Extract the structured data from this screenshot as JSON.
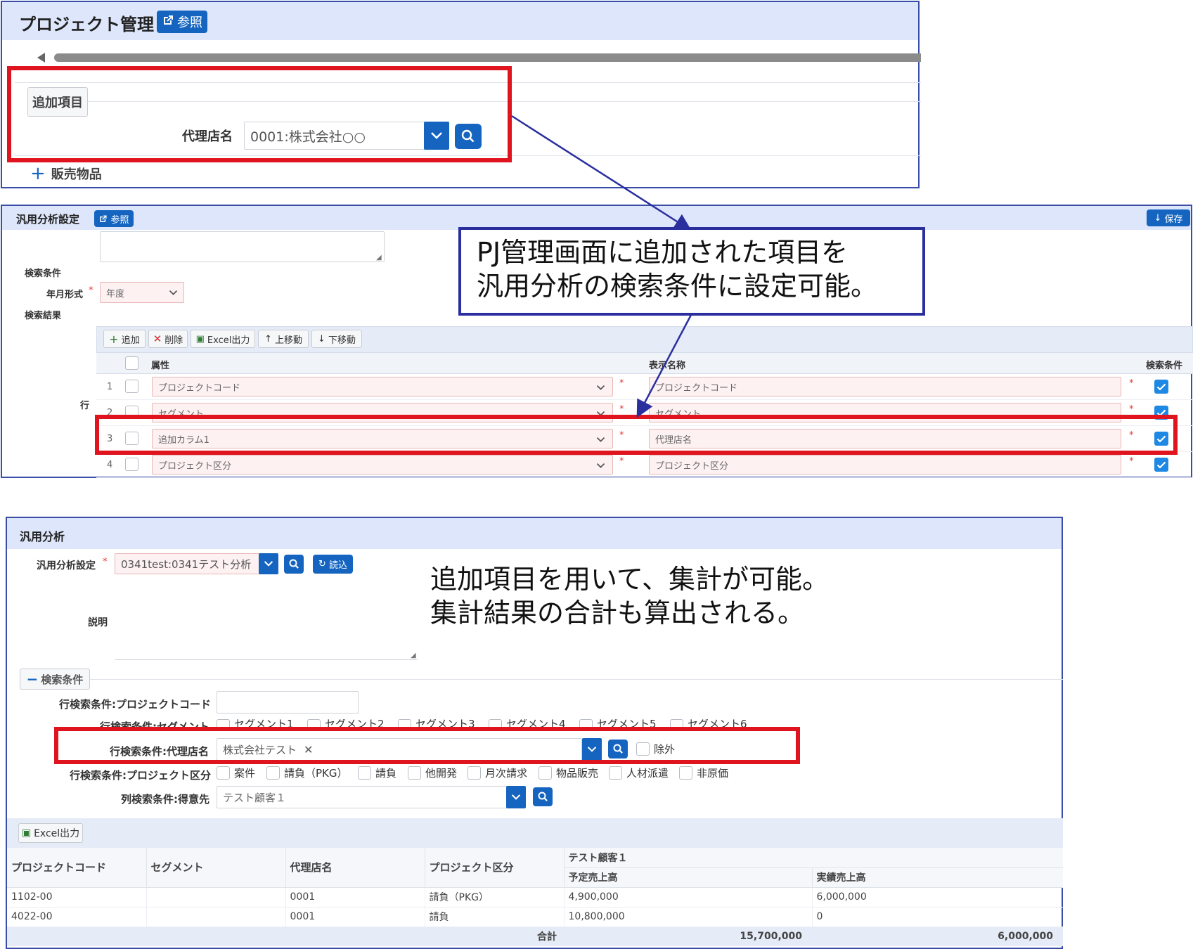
{
  "panel1": {
    "title": "プロジェクト管理",
    "ref_button": "参照",
    "section_added": "追加項目",
    "agent_label": "代理店名",
    "agent_value": "0001:株式会社○○",
    "section_products": "販売物品"
  },
  "panel2": {
    "title": "汎用分析設定",
    "ref_button": "参照",
    "save_button": "保存",
    "search_cond_label": "検索条件",
    "ym_format_label": "年月形式",
    "ym_format_value": "年度",
    "search_result_label": "検索結果",
    "toolbar": {
      "add": "追加",
      "delete": "削除",
      "excel": "Excel出力",
      "up": "上移動",
      "down": "下移動"
    },
    "row_label": "行",
    "columns": {
      "attribute": "属性",
      "display_name": "表示名称",
      "search_cond": "検索条件"
    },
    "rows": [
      {
        "no": "1",
        "attribute": "プロジェクトコード",
        "display": "プロジェクトコード"
      },
      {
        "no": "2",
        "attribute": "セグメント",
        "display": "セグメント"
      },
      {
        "no": "3",
        "attribute": "追加カラム1",
        "display": "代理店名"
      },
      {
        "no": "4",
        "attribute": "プロジェクト区分",
        "display": "プロジェクト区分"
      }
    ]
  },
  "callout1": {
    "line1": "PJ管理画面に追加された項目を",
    "line2": "汎用分析の検索条件に設定可能。"
  },
  "panel3": {
    "title": "汎用分析",
    "setting_label": "汎用分析設定",
    "setting_value": "0341test:0341テスト分析",
    "load_button": "読込",
    "desc_label": "説明",
    "cond_section": "検索条件",
    "cond_pj_code": "行検索条件:プロジェクトコード",
    "cond_segment": "行検索条件:セグメント",
    "segments": [
      "セグメント1",
      "セグメント2",
      "セグメント3",
      "セグメント4",
      "セグメント5",
      "セグメント6"
    ],
    "cond_agent": "行検索条件:代理店名",
    "agent_tag": "株式会社テスト",
    "exclude_label": "除外",
    "cond_pj_type": "行検索条件:プロジェクト区分",
    "pj_types": [
      "案件",
      "請負（PKG）",
      "請負",
      "他開発",
      "月次請求",
      "物品販売",
      "人材派遣",
      "非原価"
    ],
    "cond_customer": "列検索条件:得意先",
    "customer_value": "テスト顧客１",
    "excel_button": "Excel出力",
    "table": {
      "headers": [
        "プロジェクトコード",
        "セグメント",
        "代理店名",
        "プロジェクト区分"
      ],
      "group_header": "テスト顧客１",
      "sub_headers": [
        "予定売上高",
        "実績売上高"
      ],
      "rows": [
        {
          "code": "1102-00",
          "segment": "",
          "agent": "0001",
          "type": "請負（PKG）",
          "plan": "4,900,000",
          "actual": "6,000,000"
        },
        {
          "code": "4022-00",
          "segment": "",
          "agent": "0001",
          "type": "請負",
          "plan": "10,800,000",
          "actual": "0"
        }
      ],
      "total_label": "合計",
      "total_plan": "15,700,000",
      "total_actual": "6,000,000"
    }
  },
  "callout2": {
    "line1": "追加項目を用いて、集計が可能。",
    "line2": "集計結果の合計も算出される。"
  }
}
